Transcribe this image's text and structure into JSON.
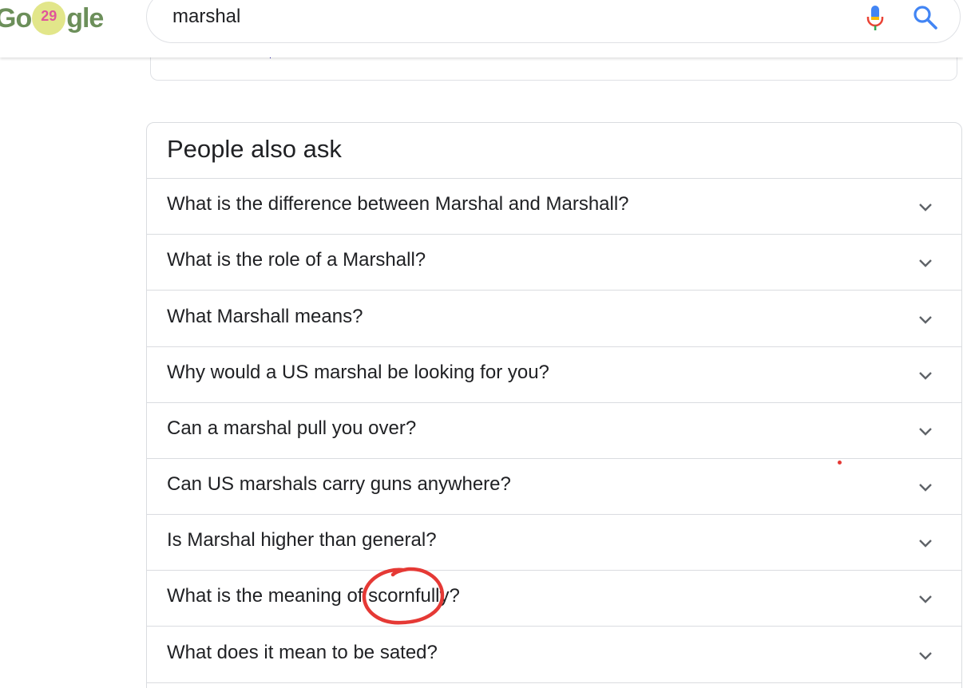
{
  "header": {
    "logo": {
      "left_text": "Go",
      "doodle_text": "29",
      "right_text": "gle",
      "doodle_color": "#e2e68a",
      "text_color": "#6c8f5a"
    },
    "search": {
      "query": "marshal"
    },
    "icons": {
      "mic": "mic-icon",
      "search": "search-icon"
    }
  },
  "people_also_ask": {
    "title": "People also ask",
    "questions": [
      "What is the difference between Marshal and Marshall?",
      "What is the role of a Marshall?",
      "What Marshall means?",
      "Why would a US marshal be looking for you?",
      "Can a marshal pull you over?",
      "Can US marshals carry guns anywhere?",
      "Is Marshal higher than general?",
      "What is the meaning of scornfully?",
      "What does it mean to be sated?"
    ]
  },
  "annotations": {
    "circle_color": "#e53935"
  }
}
